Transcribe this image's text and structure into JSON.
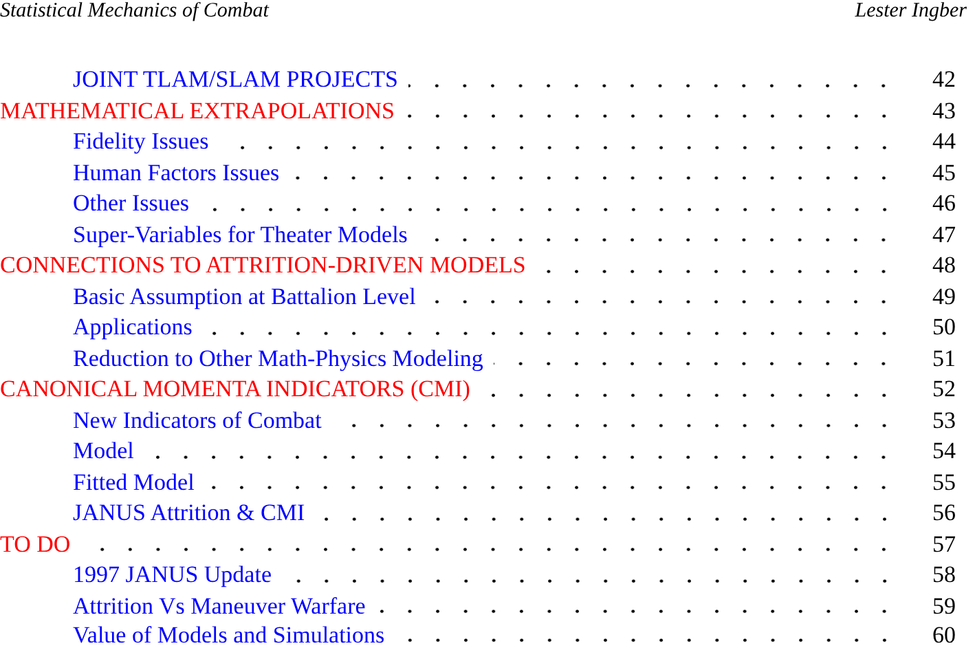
{
  "header": {
    "title": "Statistical Mechanics of Combat",
    "author": "Lester Ingber"
  },
  "sections": [
    {
      "children": [
        {
          "title": "JOINT TLAM/SLAM PROJECTS",
          "page": "42"
        }
      ]
    },
    {
      "title": "MATHEMATICAL EXTRAPOLATIONS",
      "page": "43",
      "children": [
        {
          "title": "Fidelity Issues",
          "page": "44"
        },
        {
          "title": "Human Factors Issues",
          "page": "45"
        },
        {
          "title": "Other Issues",
          "page": "46"
        },
        {
          "title": "Super-Variables for Theater Models",
          "page": "47"
        }
      ]
    },
    {
      "title": "CONNECTIONS TO ATTRITION-DRIVEN MODELS",
      "page": "48",
      "children": [
        {
          "title": "Basic Assumption at Battalion Level",
          "page": "49"
        },
        {
          "title": "Applications",
          "page": "50"
        },
        {
          "title": "Reduction to Other Math-Physics Modeling",
          "page": "51"
        }
      ]
    },
    {
      "title": "CANONICAL MOMENTA INDICATORS (CMI)",
      "page": "52",
      "children": [
        {
          "title": "New Indicators of Combat",
          "page": "53"
        },
        {
          "title": "Model",
          "page": "54"
        },
        {
          "title": "Fitted Model",
          "page": "55"
        },
        {
          "title": "JANUS Attrition & CMI",
          "page": "56"
        }
      ]
    },
    {
      "title": "TO DO",
      "page": "57",
      "children": [
        {
          "title": "1997 JANUS Update",
          "page": "58"
        },
        {
          "title": "Attrition Vs Maneuver Warfare",
          "page": "59"
        },
        {
          "title": "Value of Models and Simulations",
          "page": "60"
        }
      ]
    }
  ]
}
